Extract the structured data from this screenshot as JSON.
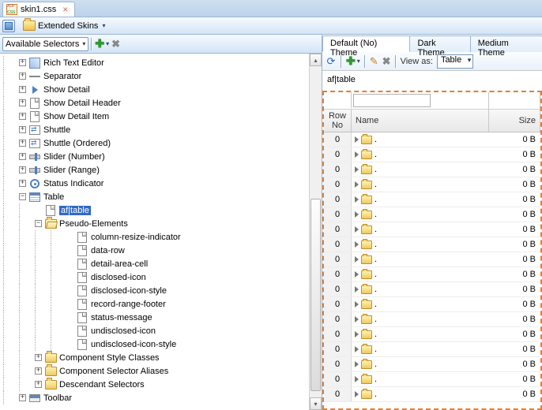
{
  "file_tab": {
    "name": "skin1.css"
  },
  "toolbar": {
    "extended_skins": "Extended Skins"
  },
  "left": {
    "combo_label": "Available Selectors",
    "tree": {
      "root_items": [
        {
          "label": "Rich Text Editor",
          "icon": "prop"
        },
        {
          "label": "Separator",
          "icon": "sep"
        },
        {
          "label": "Show Detail",
          "icon": "tri"
        },
        {
          "label": "Show Detail Header",
          "icon": "page"
        },
        {
          "label": "Show Detail Item",
          "icon": "page"
        },
        {
          "label": "Shuttle",
          "icon": "shuttle"
        },
        {
          "label": "Shuttle (Ordered)",
          "icon": "shuttle"
        },
        {
          "label": "Slider (Number)",
          "icon": "slider"
        },
        {
          "label": "Slider (Range)",
          "icon": "slider"
        },
        {
          "label": "Status Indicator",
          "icon": "status"
        }
      ],
      "table_label": "Table",
      "af_table": "af|table",
      "pseudo_label": "Pseudo-Elements",
      "pseudo_items": [
        "column-resize-indicator",
        "data-row",
        "detail-area-cell",
        "disclosed-icon",
        "disclosed-icon-style",
        "record-range-footer",
        "status-message",
        "undisclosed-icon",
        "undisclosed-icon-style"
      ],
      "more_items": [
        "Component Style Classes",
        "Component Selector Aliases",
        "Descendant Selectors"
      ],
      "toolbar_label": "Toolbar"
    }
  },
  "right": {
    "tabs": [
      "Default (No) Theme",
      "Dark Theme",
      "Medium Theme"
    ],
    "view_as_label": "View as:",
    "view_as_value": "Table",
    "component": "af|table",
    "headers": {
      "row": "Row",
      "no": "No",
      "name": "Name",
      "size": "Size"
    },
    "row_no": "0",
    "name_value": ".",
    "size_value": "0 B",
    "row_count": 18
  }
}
